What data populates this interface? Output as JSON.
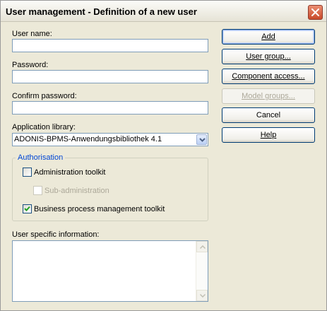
{
  "window": {
    "title": "User management - Definition of a new user",
    "close_icon": "close-x-icon"
  },
  "form": {
    "user_name_label": "User name:",
    "user_name_value": "",
    "password_label": "Password:",
    "password_value": "",
    "confirm_password_label": "Confirm password:",
    "confirm_password_value": "",
    "library_label": "Application library:",
    "library_value": "ADONIS-BPMS-Anwendungsbibliothek 4.1",
    "user_info_label": "User specific information:",
    "user_info_value": ""
  },
  "authorisation": {
    "title": "Authorisation",
    "items": [
      {
        "label": "Administration toolkit",
        "checked": false,
        "enabled": true
      },
      {
        "label": "Sub-administration",
        "checked": false,
        "enabled": false
      },
      {
        "label": "Business process management toolkit",
        "checked": true,
        "enabled": true
      }
    ]
  },
  "buttons": {
    "add": "Add",
    "user_group": "User group...",
    "component_access": "Component access...",
    "model_groups": "Model groups...",
    "cancel": "Cancel",
    "help": "Help"
  },
  "colors": {
    "dialog_bg": "#ece9d8",
    "group_title": "#0046d5",
    "close_button": "#c94a2b",
    "field_border": "#7f9db9"
  }
}
